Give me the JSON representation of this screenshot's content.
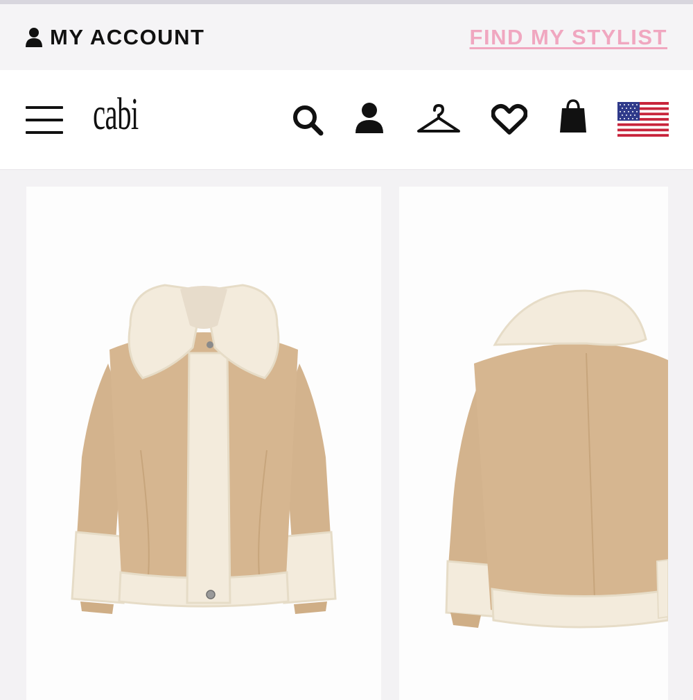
{
  "utility_bar": {
    "account_label": "MY ACCOUNT",
    "find_stylist_label": "FIND MY STYLIST",
    "link_color": "#f0a7c0"
  },
  "header": {
    "logo_text": "cabi",
    "icons": [
      "menu-icon",
      "search-icon",
      "account-icon",
      "hanger-icon",
      "heart-icon",
      "shopping-bag-icon",
      "us-flag-icon"
    ]
  },
  "products": [
    {
      "view": "front",
      "image": "beige shearling jacket, front view"
    },
    {
      "view": "back",
      "image": "beige shearling jacket, back view"
    }
  ],
  "colors": {
    "jacket_body": "#d6b690",
    "sherpa": "#f3ebdc",
    "text": "#111111"
  }
}
